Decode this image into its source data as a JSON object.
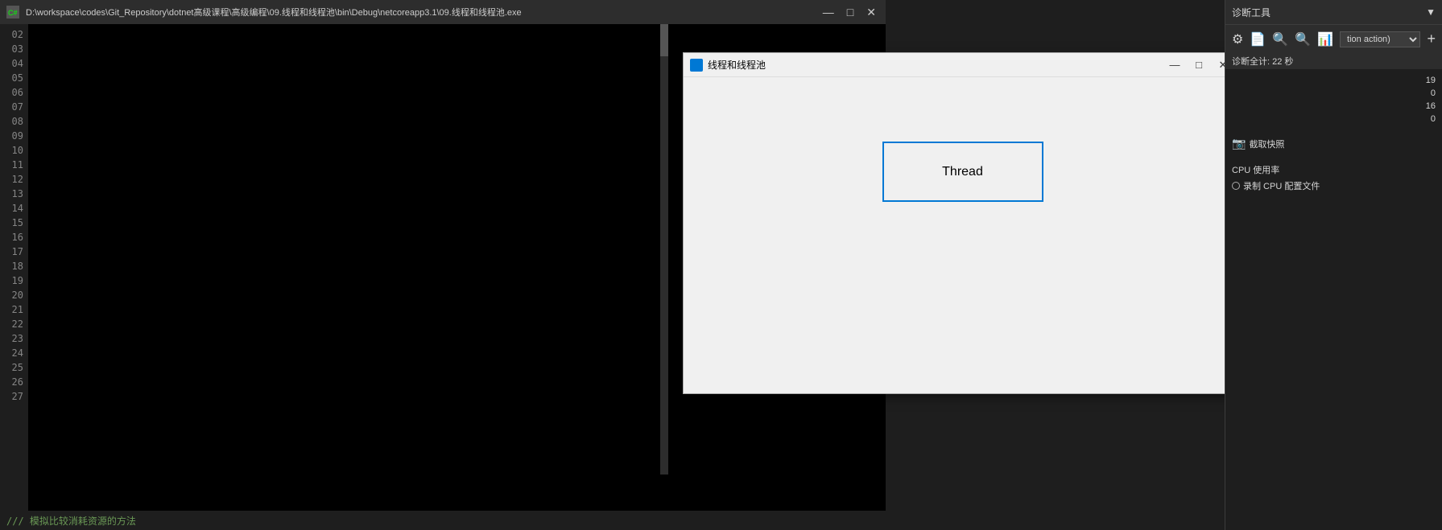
{
  "console": {
    "title": "D:\\workspace\\codes\\Git_Repository\\dotnet高级课程\\高级编程\\09.线程和线程池\\bin\\Debug\\netcoreapp3.1\\09.线程和线程池.exe",
    "icon": "▶",
    "min_btn": "—",
    "max_btn": "□",
    "close_btn": "✕"
  },
  "line_numbers": [
    "02",
    "03",
    "04",
    "05",
    "06",
    "07",
    "08",
    "09",
    "10",
    "11",
    "12",
    "13",
    "14",
    "15",
    "16",
    "17",
    "18",
    "19",
    "20",
    "21",
    "22",
    "23",
    "24",
    "25",
    "26",
    "27"
  ],
  "bottom_bar": {
    "comment": "/// 模拟比较消耗资源的方法"
  },
  "wpf_window": {
    "title": "线程和线程池",
    "icon_color": "#0078d4",
    "min_btn": "—",
    "max_btn": "□",
    "close_btn": "✕",
    "thread_button_label": "Thread"
  },
  "diagnostics": {
    "header_title": "诊断工具",
    "dropdown_value": "tion action)",
    "plus_btn": "+",
    "summary_text": "诊断全计: 22 秒",
    "counter_rows": [
      {
        "label": "",
        "value": "19"
      },
      {
        "label": "",
        "value": "0"
      },
      {
        "label": "",
        "value": "16"
      },
      {
        "label": "",
        "value": "0"
      }
    ],
    "snapshot_label": "截取快照",
    "cpu_section_title": "CPU 使用率",
    "record_cpu_label": "录制 CPU 配置文件",
    "icons": {
      "gear": "⚙",
      "doc": "📄",
      "search": "🔍",
      "zoom_in": "🔍",
      "chart": "📊"
    }
  }
}
